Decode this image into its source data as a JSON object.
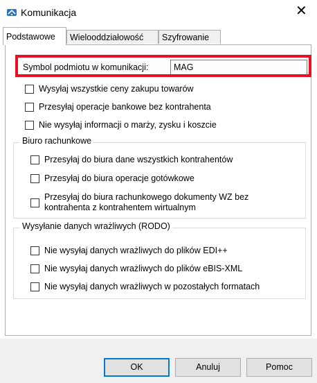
{
  "window": {
    "title": "Komunikacja",
    "close_glyph": "✕"
  },
  "tabs": [
    {
      "label": "Podstawowe",
      "active": true
    },
    {
      "label": "Wielooddziałowość",
      "active": false
    },
    {
      "label": "Szyfrowanie",
      "active": false
    }
  ],
  "symbol": {
    "label": "Symbol podmiotu w komunikacji:",
    "value": "MAG"
  },
  "options": [
    {
      "label": "Wysyłaj wszystkie ceny zakupu towarów",
      "checked": false
    },
    {
      "label": "Przesyłaj operacje bankowe bez kontrahenta",
      "checked": false
    },
    {
      "label": "Nie wysyłaj informacji o marży, zysku i koszcie",
      "checked": false
    }
  ],
  "biuro": {
    "title": "Biuro rachunkowe",
    "options": [
      {
        "label": "Przesyłaj do biura dane wszystkich kontrahentów",
        "checked": false
      },
      {
        "label": "Przesyłaj do biura operacje gotówkowe",
        "checked": false
      },
      {
        "label_line1": "Przesyłaj do biura rachunkowego dokumenty WZ bez",
        "label_line2": "kontrahenta z kontrahentem wirtualnym",
        "checked": false
      }
    ]
  },
  "rodo": {
    "title": "Wysyłanie danych wrażliwych (RODO)",
    "options": [
      {
        "label": "Nie wysyłaj danych wrażliwych do plików EDI++",
        "checked": false
      },
      {
        "label": "Nie wysyłaj danych wrażliwych do plików eBIS-XML",
        "checked": false
      },
      {
        "label": "Nie wysyłaj danych wrażliwych w pozostałych formatach",
        "checked": false
      }
    ]
  },
  "buttons": {
    "ok": "OK",
    "cancel": "Anuluj",
    "help": "Pomoc"
  },
  "colors": {
    "highlight": "#e81123",
    "footer_bg": "#f0f0f0",
    "button_bg": "#e1e1e1",
    "default_border": "#0078d7"
  },
  "icons": {
    "app": "komunikacja-app-icon",
    "close": "close-icon"
  }
}
